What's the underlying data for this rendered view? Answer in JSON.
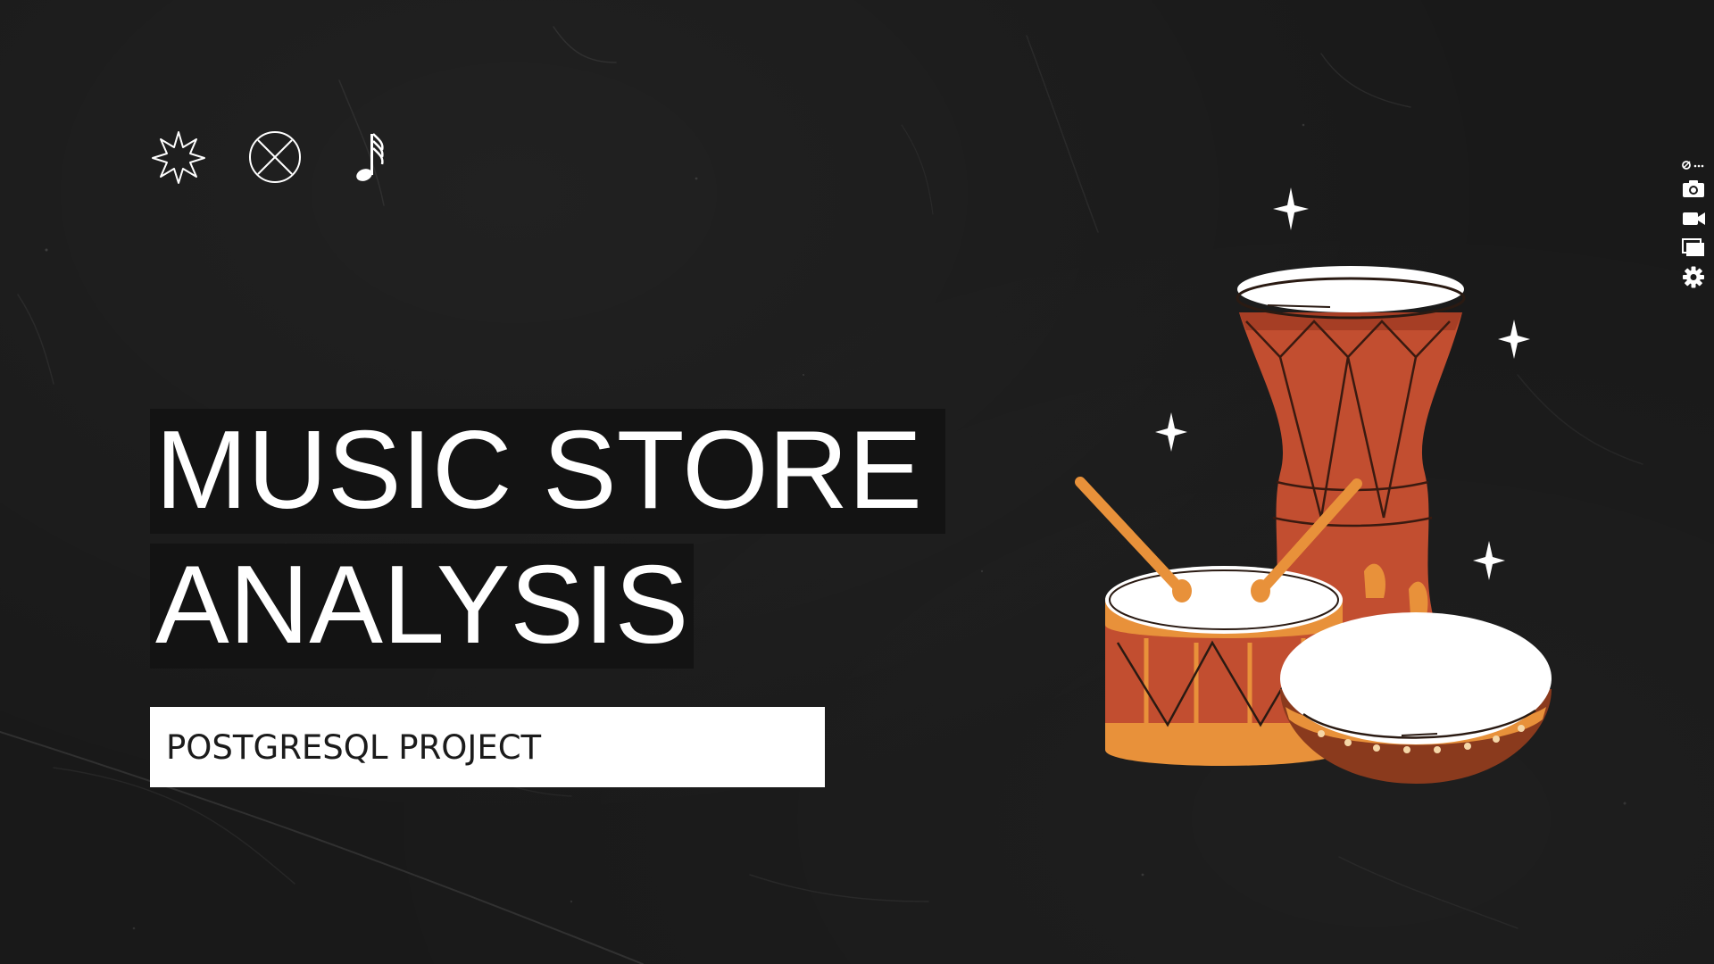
{
  "slide": {
    "title_line_1": "MUSIC STORE",
    "title_line_2": "ANALYSIS",
    "subtitle": "POSTGRESQL PROJECT"
  },
  "decor_icons": [
    "star-burst-icon",
    "crossed-circle-icon",
    "music-note-icon"
  ],
  "illustration": "drums-illustration",
  "toolbar": {
    "items": [
      "link-menu-icon",
      "camera-icon",
      "video-icon",
      "windows-icon",
      "gear-icon"
    ]
  },
  "colors": {
    "background": "#191919",
    "title_text": "#ffffff",
    "title_highlight": "#131313",
    "subtitle_box": "#ffffff",
    "subtitle_text": "#1b1b1b",
    "drum_red": "#c24e30",
    "drum_orange": "#e8913a",
    "drum_brown": "#8a3a1d"
  }
}
